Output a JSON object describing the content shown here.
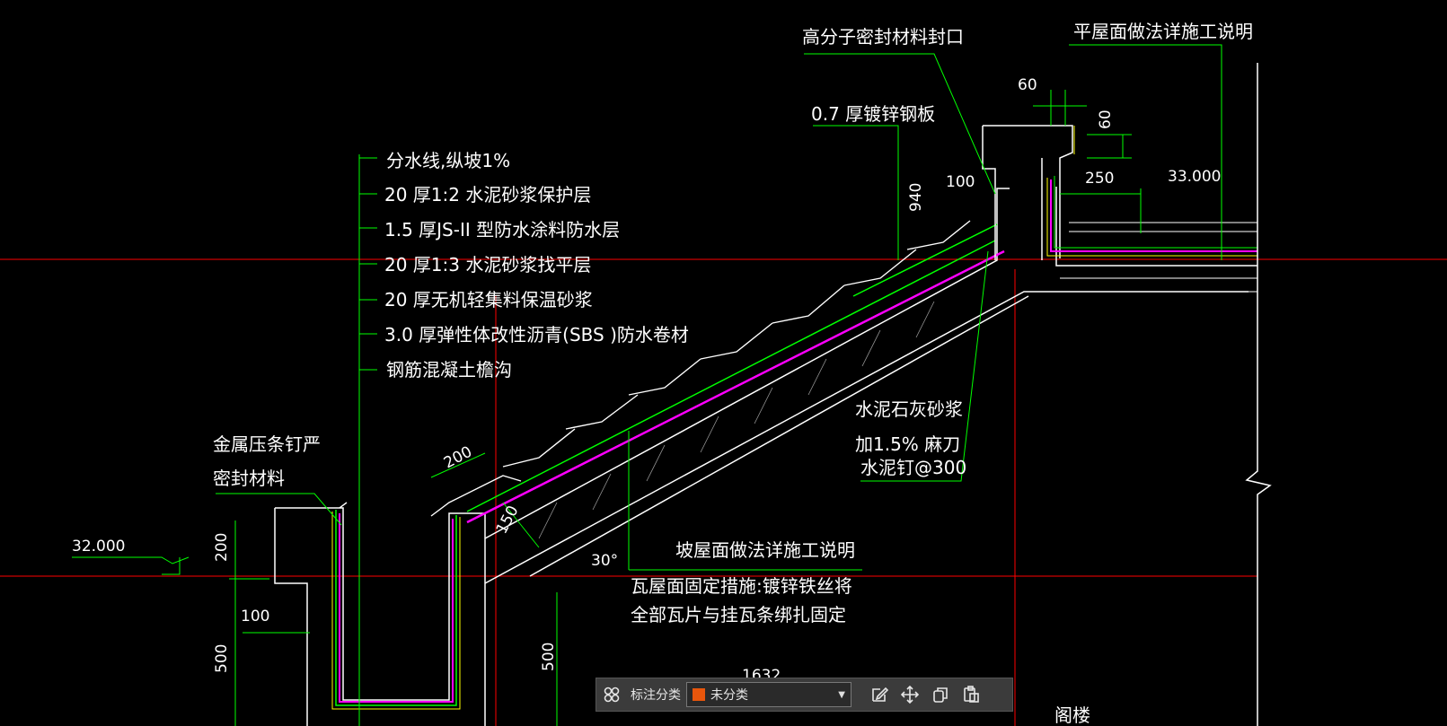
{
  "drawing": {
    "labels": {
      "seal_mouth": "高分子密封材料封口",
      "flat_roof_note": "平屋面做法详施工说明",
      "steel_plate": "0.7  厚镀锌钢板",
      "layer1": "分水线,纵坡1%",
      "layer2": "20  厚1:2   水泥砂浆保护层",
      "layer3": "1.5  厚JS-II   型防水涂料防水层",
      "layer4": "20  厚1:3   水泥砂浆找平层",
      "layer5": "20  厚无机轻集料保温砂浆",
      "layer6": "3.0  厚弹性体改性沥青(SBS  )防水卷材",
      "layer7": "钢筋混凝土檐沟",
      "metal_strip1": "金属压条钉严",
      "metal_strip2": "密封材料",
      "mortar1": "水泥石灰砂浆",
      "mortar2": "加1.5%  麻刀",
      "mortar3": "水泥钉@300",
      "slope_note": "坡屋面做法详施工说明",
      "tile_fix1": "瓦屋面固定措施:镀锌铁丝将",
      "tile_fix2": "全部瓦片与挂瓦条绑扎固定",
      "attic": "阁楼"
    },
    "dimensions": {
      "d60_top": "60",
      "d60_side": "60",
      "d100_top": "100",
      "d250": "250",
      "elev_33": "33.000",
      "elev_32": "32.000",
      "d200_left": "200",
      "d100_left": "100",
      "d500_left": "500",
      "d500_mid": "500",
      "d200_slope": "200",
      "d150": "150",
      "angle": "30°",
      "d1632": "1632",
      "d940": "940"
    }
  },
  "toolbar": {
    "category_label": "标注分类",
    "selected_value": "未分类",
    "swatch_color": "#e8560c"
  },
  "colors": {
    "red_line": "#ff0000",
    "green_line": "#00ff00",
    "magenta": "#ff00ff",
    "yellow": "#ffff00",
    "white": "#ffffff"
  }
}
